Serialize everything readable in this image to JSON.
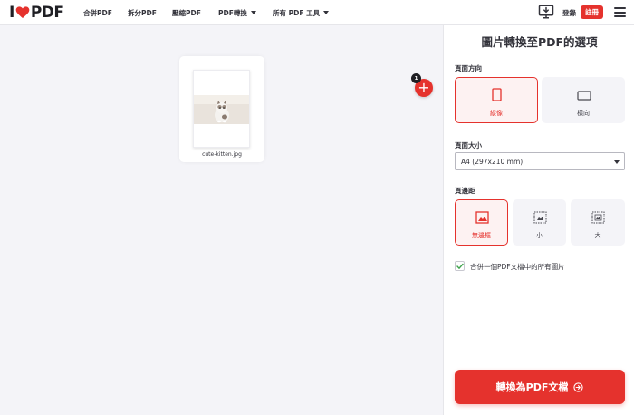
{
  "header": {
    "logo_left": "I",
    "logo_right": "PDF",
    "nav": [
      {
        "label": "合併PDF"
      },
      {
        "label": "拆分PDF"
      },
      {
        "label": "壓縮PDF"
      },
      {
        "label": "PDF轉換"
      },
      {
        "label": "所有 PDF 工具"
      }
    ],
    "login": "登錄",
    "signup": "註冊"
  },
  "workspace": {
    "file_name": "cute-kitten.jpg",
    "file_count": "1",
    "add_label": "+"
  },
  "sidebar": {
    "title": "圖片轉換至PDF的選項",
    "orientation": {
      "label": "頁面方向",
      "options": [
        "縱像",
        "橫向"
      ],
      "selected": "縱像"
    },
    "page_size": {
      "label": "頁面大小",
      "value": "A4 (297x210 mm)"
    },
    "margin": {
      "label": "頁邊距",
      "options": [
        "無邊框",
        "小",
        "大"
      ],
      "selected": "無邊框"
    },
    "merge": {
      "label": "合併一個PDF文檔中的所有圖片",
      "checked": true
    },
    "convert_label": "轉換為PDF文檔"
  },
  "colors": {
    "accent": "#e5322d",
    "text": "#33333b",
    "panel_bg": "#f4f4f8"
  }
}
